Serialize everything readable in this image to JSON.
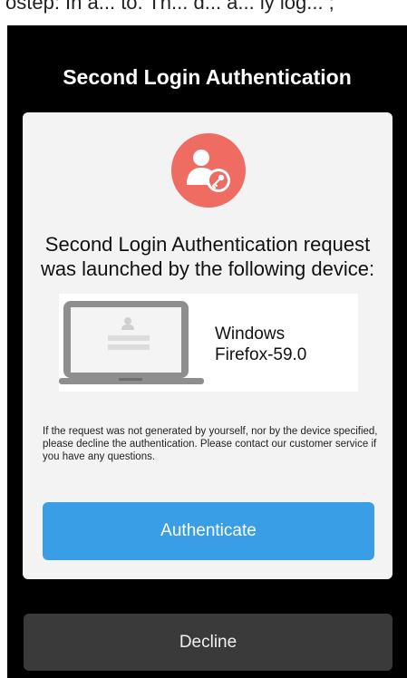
{
  "top_caption": "ostep: In a... to. Th... d... a... ly log... ;",
  "header": {
    "title": "Second Login Authentication"
  },
  "card": {
    "icon": "user-key-icon",
    "message_line1": "Second Login Authentication request",
    "message_line2": "was launched by the following device:",
    "device": {
      "icon": "laptop-icon",
      "os": "Windows",
      "browser": "Firefox-59.0"
    },
    "note": "If the request was not generated by yourself, nor by the device specified, please decline the authentication. Please contact our customer service if you have any questions.",
    "authenticate_label": "Authenticate"
  },
  "decline_label": "Decline",
  "colors": {
    "background": "#000000",
    "card": "#f3f3f3",
    "accent": "#3a9ee6",
    "icon_circle": "#ef6c63",
    "decline": "#3a3a3a"
  }
}
